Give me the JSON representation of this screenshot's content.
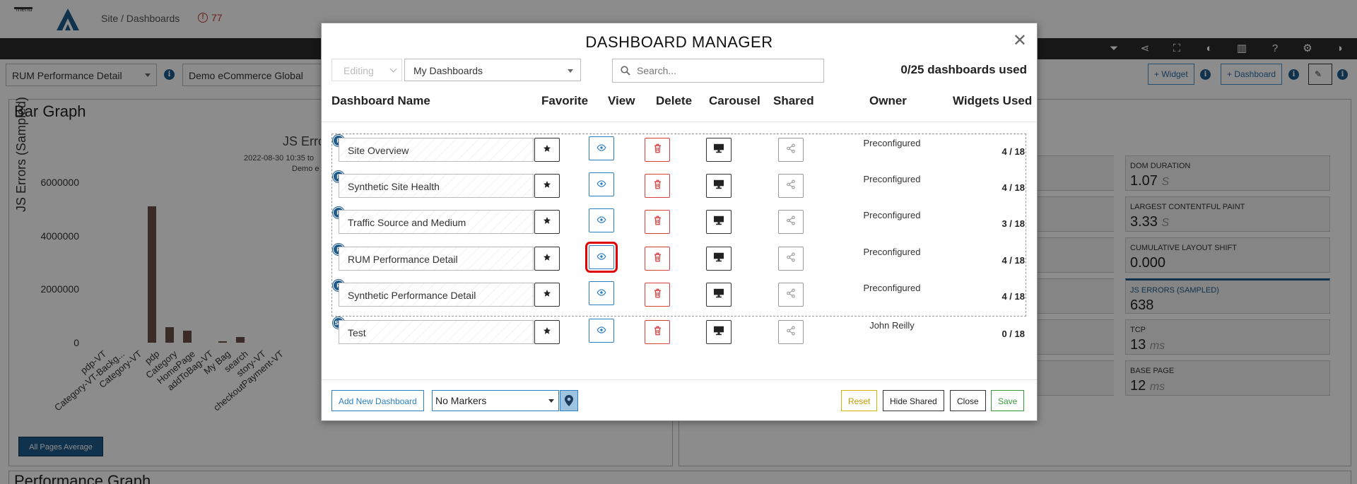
{
  "app": {
    "menu_label": "menu",
    "breadcrumb": "Site / Dashboards",
    "alert_count": "77",
    "dashboard_select": "RUM Performance Detail",
    "site_select": "Demo eCommerce Global",
    "add_widget": "+ Widget",
    "add_dashboard": "+ Dashboard",
    "toolbar_icons": [
      "filter-icon",
      "share-icon",
      "fullscreen-icon",
      "contrast-icon",
      "columns-icon",
      "help-icon",
      "settings-icon",
      "contrast-toggle-icon"
    ]
  },
  "bar_panel": {
    "title": "Bar Graph",
    "chart_title": "JS Erro",
    "subtitle_1": "2022-08-30 10:35 to",
    "subtitle_2": "Demo e",
    "average_button": "All Pages Average"
  },
  "performance_panel": {
    "title": "Performance Graph"
  },
  "chart_data": {
    "type": "bar",
    "title": "JS Erro",
    "ylabel": "JS Errors (Sampled)",
    "ylim": [
      0,
      6000000
    ],
    "yticks": [
      "6000000",
      "4000000",
      "2000000",
      "0"
    ],
    "categories": [
      "pdp-VT",
      "Category-VT-Backg...",
      "Category-VT",
      "pdp",
      "Category",
      "HomePage",
      "addToBag-VT",
      "My Bag",
      "search",
      "story-VT",
      "checkoutPayment-VT"
    ],
    "values": [
      0,
      0,
      0,
      5100000,
      580000,
      440000,
      0,
      60000,
      210000,
      0,
      0
    ]
  },
  "metrics": [
    {
      "label": "DOM DURATION",
      "value": "1.07",
      "unit": "S"
    },
    {
      "label": "LARGEST CONTENTFUL PAINT",
      "value": "3.33",
      "unit": "S"
    },
    {
      "label": "CUMULATIVE LAYOUT SHIFT",
      "value": "0.000",
      "unit": ""
    },
    {
      "label": "JS ERRORS (SAMPLED)",
      "value": "638",
      "unit": ""
    },
    {
      "label": "TCP",
      "value": "13",
      "unit": "ms"
    },
    {
      "label": "BASE PAGE",
      "value": "12",
      "unit": "ms"
    }
  ],
  "modal": {
    "title": "DASHBOARD MANAGER",
    "close": "✕",
    "editing": "Editing",
    "filter": "My Dashboards",
    "search_placeholder": "Search...",
    "usage": "0/25 dashboards used",
    "columns": {
      "name": "Dashboard Name",
      "favorite": "Favorite",
      "view": "View",
      "delete": "Delete",
      "carousel": "Carousel",
      "shared": "Shared",
      "owner": "Owner",
      "widgets": "Widgets Used"
    },
    "rows": [
      {
        "badge": "P",
        "name": "Site Overview",
        "owner": "Preconfigured",
        "widgets": "4 / 18"
      },
      {
        "badge": "P",
        "name": "Synthetic Site Health",
        "owner": "Preconfigured",
        "widgets": "4 / 18"
      },
      {
        "badge": "P",
        "name": "Traffic Source and Medium",
        "owner": "Preconfigured",
        "widgets": "3 / 18"
      },
      {
        "badge": "P",
        "name": "RUM Performance Detail",
        "owner": "Preconfigured",
        "widgets": "4 / 18"
      },
      {
        "badge": "P",
        "name": "Synthetic Performance Detail",
        "owner": "Preconfigured",
        "widgets": "4 / 18"
      },
      {
        "badge": "SA",
        "name": "Test",
        "owner": "John Reilly",
        "widgets": "0 / 18"
      }
    ],
    "footer": {
      "add_new": "Add New Dashboard",
      "markers": "No Markers",
      "reset": "Reset",
      "hide_shared": "Hide Shared",
      "close": "Close",
      "save": "Save"
    }
  }
}
